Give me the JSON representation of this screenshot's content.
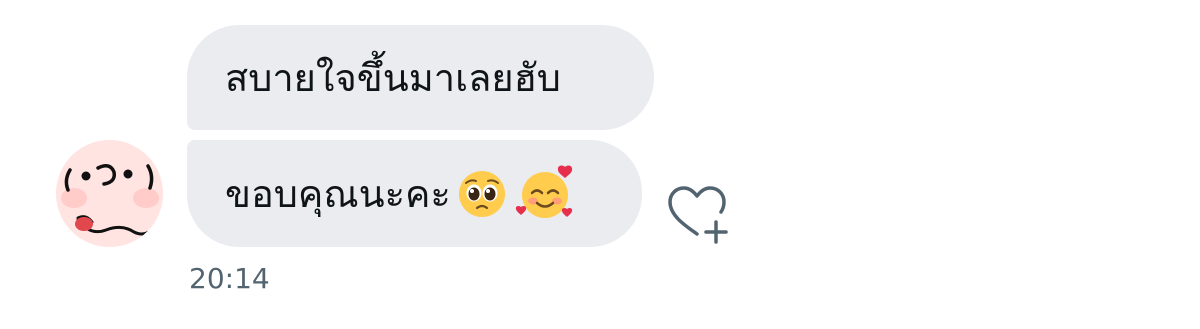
{
  "messages": [
    {
      "text": "สบายใจขึ้นมาเลยฮับ"
    },
    {
      "text": "ขอบคุณนะคะ",
      "emojis": [
        "pleading-face-emoji",
        "smiling-face-with-hearts-emoji"
      ]
    }
  ],
  "timestamp": "20:14",
  "icons": {
    "like": "heart-plus-icon",
    "avatar": "cartoon-face-avatar"
  },
  "colors": {
    "bubble_bg": "#eaecef",
    "text": "#0f1419",
    "muted": "#536471"
  }
}
